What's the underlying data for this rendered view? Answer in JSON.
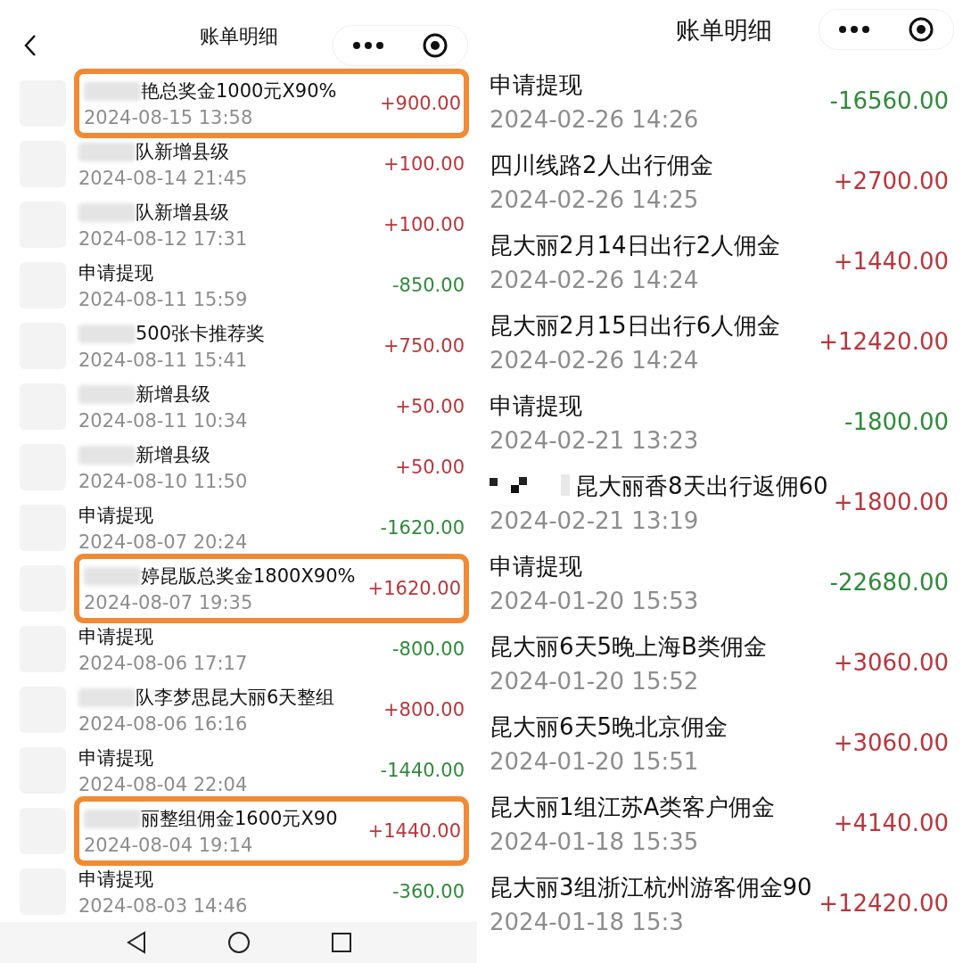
{
  "left_screen": {
    "header": {
      "title": "账单明细"
    },
    "rows": [
      {
        "title": "艳总奖金1000元X90%",
        "blurred": true,
        "date": "2024-08-15 13:58",
        "amount": "+900.00",
        "kind": "credit",
        "highlighted": true
      },
      {
        "title": "队新增县级",
        "blurred": true,
        "date": "2024-08-14 21:45",
        "amount": "+100.00",
        "kind": "credit",
        "highlighted": false
      },
      {
        "title": "队新增县级",
        "blurred": true,
        "date": "2024-08-12 17:31",
        "amount": "+100.00",
        "kind": "credit",
        "highlighted": false
      },
      {
        "title": "申请提现",
        "blurred": false,
        "date": "2024-08-11 15:59",
        "amount": "-850.00",
        "kind": "debit",
        "highlighted": false
      },
      {
        "title": "500张卡推荐奖",
        "blurred": true,
        "date": "2024-08-11 15:41",
        "amount": "+750.00",
        "kind": "credit",
        "highlighted": false
      },
      {
        "title": "新增县级",
        "blurred": true,
        "date": "2024-08-11 10:34",
        "amount": "+50.00",
        "kind": "credit",
        "highlighted": false
      },
      {
        "title": "新增县级",
        "blurred": true,
        "date": "2024-08-10 11:50",
        "amount": "+50.00",
        "kind": "credit",
        "highlighted": false
      },
      {
        "title": "申请提现",
        "blurred": false,
        "date": "2024-08-07 20:24",
        "amount": "-1620.00",
        "kind": "debit",
        "highlighted": false
      },
      {
        "title": "婷昆版总奖金1800X90%",
        "blurred": true,
        "date": "2024-08-07 19:35",
        "amount": "+1620.00",
        "kind": "credit",
        "highlighted": true
      },
      {
        "title": "申请提现",
        "blurred": false,
        "date": "2024-08-06 17:17",
        "amount": "-800.00",
        "kind": "debit",
        "highlighted": false
      },
      {
        "title": "队李梦思昆大丽6天整组",
        "blurred": true,
        "date": "2024-08-06 16:16",
        "amount": "+800.00",
        "kind": "credit",
        "highlighted": false
      },
      {
        "title": "申请提现",
        "blurred": false,
        "date": "2024-08-04 22:04",
        "amount": "-1440.00",
        "kind": "debit",
        "highlighted": false
      },
      {
        "title": "丽整组佣金1600元X90",
        "blurred": true,
        "date": "2024-08-04 19:14",
        "amount": "+1440.00",
        "kind": "credit",
        "highlighted": true
      },
      {
        "title": "申请提现",
        "blurred": false,
        "date": "2024-08-03 14:46",
        "amount": "-360.00",
        "kind": "debit",
        "highlighted": false
      }
    ]
  },
  "right_screen": {
    "header": {
      "title": "账单明细"
    },
    "rows": [
      {
        "title": "申请提现",
        "pixelated": false,
        "date": "2024-02-26 14:26",
        "amount": "-16560.00",
        "kind": "debit"
      },
      {
        "title": "四川线路2人出行佣金",
        "pixelated": false,
        "date": "2024-02-26 14:25",
        "amount": "+2700.00",
        "kind": "credit"
      },
      {
        "title": "昆大丽2月14日出行2人佣金",
        "pixelated": false,
        "date": "2024-02-26 14:24",
        "amount": "+1440.00",
        "kind": "credit"
      },
      {
        "title": "昆大丽2月15日出行6人佣金",
        "pixelated": false,
        "date": "2024-02-26 14:24",
        "amount": "+12420.00",
        "kind": "credit"
      },
      {
        "title": "申请提现",
        "pixelated": false,
        "date": "2024-02-21 13:23",
        "amount": "-1800.00",
        "kind": "debit"
      },
      {
        "title": "昆大丽香8天出行返佣60",
        "pixelated": true,
        "date": "2024-02-21 13:19",
        "amount": "+1800.00",
        "kind": "credit"
      },
      {
        "title": "申请提现",
        "pixelated": false,
        "date": "2024-01-20 15:53",
        "amount": "-22680.00",
        "kind": "debit"
      },
      {
        "title": "昆大丽6天5晚上海B类佣金",
        "pixelated": false,
        "date": "2024-01-20 15:52",
        "amount": "+3060.00",
        "kind": "credit"
      },
      {
        "title": "昆大丽6天5晚北京佣金",
        "pixelated": false,
        "date": "2024-01-20 15:51",
        "amount": "+3060.00",
        "kind": "credit"
      },
      {
        "title": "昆大丽1组江苏A类客户佣金",
        "pixelated": false,
        "date": "2024-01-18 15:35",
        "amount": "+4140.00",
        "kind": "credit"
      },
      {
        "title": "昆大丽3组浙江杭州游客佣金90",
        "pixelated": false,
        "date": "2024-01-18 15:3",
        "amount": "+12420.00",
        "kind": "credit"
      }
    ]
  }
}
